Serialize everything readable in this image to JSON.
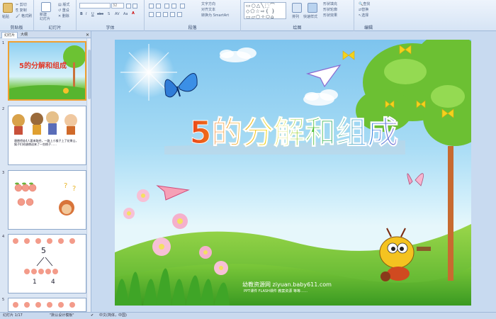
{
  "ribbon": {
    "clipboard": {
      "label": "剪贴板",
      "paste": "粘贴",
      "cut": "剪切",
      "copy": "复制",
      "format_painter": "格式刷"
    },
    "slides": {
      "label": "幻灯片",
      "new_slide": "新建\n幻灯片",
      "layout": "版式",
      "reset": "重设",
      "delete": "删除"
    },
    "font": {
      "label": "字体",
      "font_name": "",
      "font_size": "32"
    },
    "paragraph": {
      "label": "段落",
      "text_direction": "文字方向",
      "align_text": "对齐文本",
      "smartart": "转换为 SmartArt"
    },
    "drawing": {
      "label": "绘图",
      "arrange": "排列",
      "quick_styles": "快速样式",
      "shape_fill": "形状填充",
      "shape_outline": "形状轮廓",
      "shape_effects": "形状效果"
    },
    "editing": {
      "label": "编辑",
      "find": "查找",
      "replace": "替换",
      "select": "选择"
    }
  },
  "panel": {
    "tabs": [
      "幻灯片",
      "大纲"
    ],
    "slides": [
      {
        "num": "1",
        "title": "5的分解和组成"
      },
      {
        "num": "2",
        "text": "唐僧师徒4人要来取经，一路上小猴子上了花果山，猴子们给唐僧送来了一些桃子……"
      },
      {
        "num": "3"
      },
      {
        "num": "4",
        "digits": [
          "5",
          "1",
          "4"
        ]
      },
      {
        "num": "5"
      }
    ]
  },
  "slide": {
    "title": "5的分解和组成",
    "watermark_line1": "幼教资源网 ziyuan.baby611.com",
    "watermark_line2": "PPT课件  FLASH课件  教案资源  等等……"
  },
  "status": {
    "slide_info": "幻灯片 1/17",
    "theme": "\"默认设计模板\"",
    "language": "中文(简体，中国)"
  },
  "colors": {
    "title_gradient": [
      "#e8261c",
      "#f29a18",
      "#f2e21c",
      "#3cbb3a",
      "#2a8fe0",
      "#7a3ec8"
    ],
    "selected_thumb_border": "#f0a030"
  }
}
